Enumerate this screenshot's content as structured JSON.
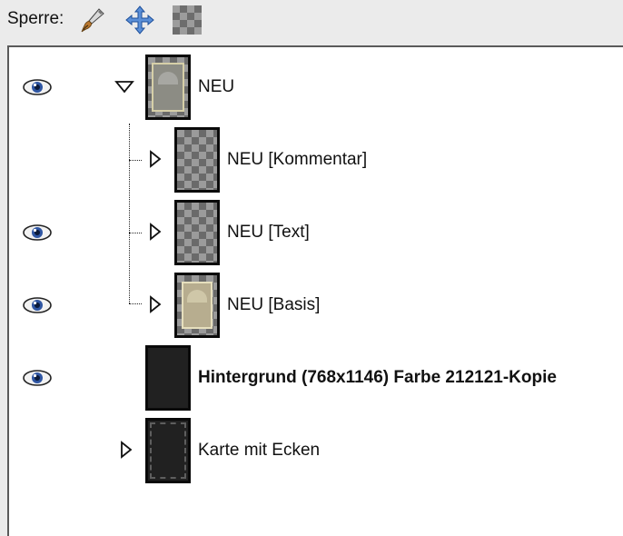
{
  "lockbar": {
    "label": "Sperre:",
    "buttons": [
      {
        "icon": "paintbrush-lock-icon"
      },
      {
        "icon": "move-lock-icon"
      },
      {
        "icon": "alpha-lock-icon"
      }
    ]
  },
  "layers": [
    {
      "name": "NEU",
      "visible": true,
      "expanded": true,
      "bold": false
    },
    {
      "name": "NEU [Kommentar]",
      "visible": false,
      "expanded": false,
      "bold": false
    },
    {
      "name": "NEU [Text]",
      "visible": true,
      "expanded": false,
      "bold": false
    },
    {
      "name": "NEU [Basis]",
      "visible": true,
      "expanded": false,
      "bold": false
    },
    {
      "name": "Hintergrund (768x1146) Farbe 212121-Kopie",
      "visible": true,
      "expanded": false,
      "bold": true
    },
    {
      "name": "Karte mit Ecken",
      "visible": false,
      "expanded": false,
      "bold": false
    }
  ],
  "colors": {
    "eye_iris": "#2f56a3",
    "panel_bg": "#ffffff",
    "toolbar_bg": "#ebebeb",
    "thumb_border": "#0a0a0a",
    "background_layer": "#212121"
  }
}
